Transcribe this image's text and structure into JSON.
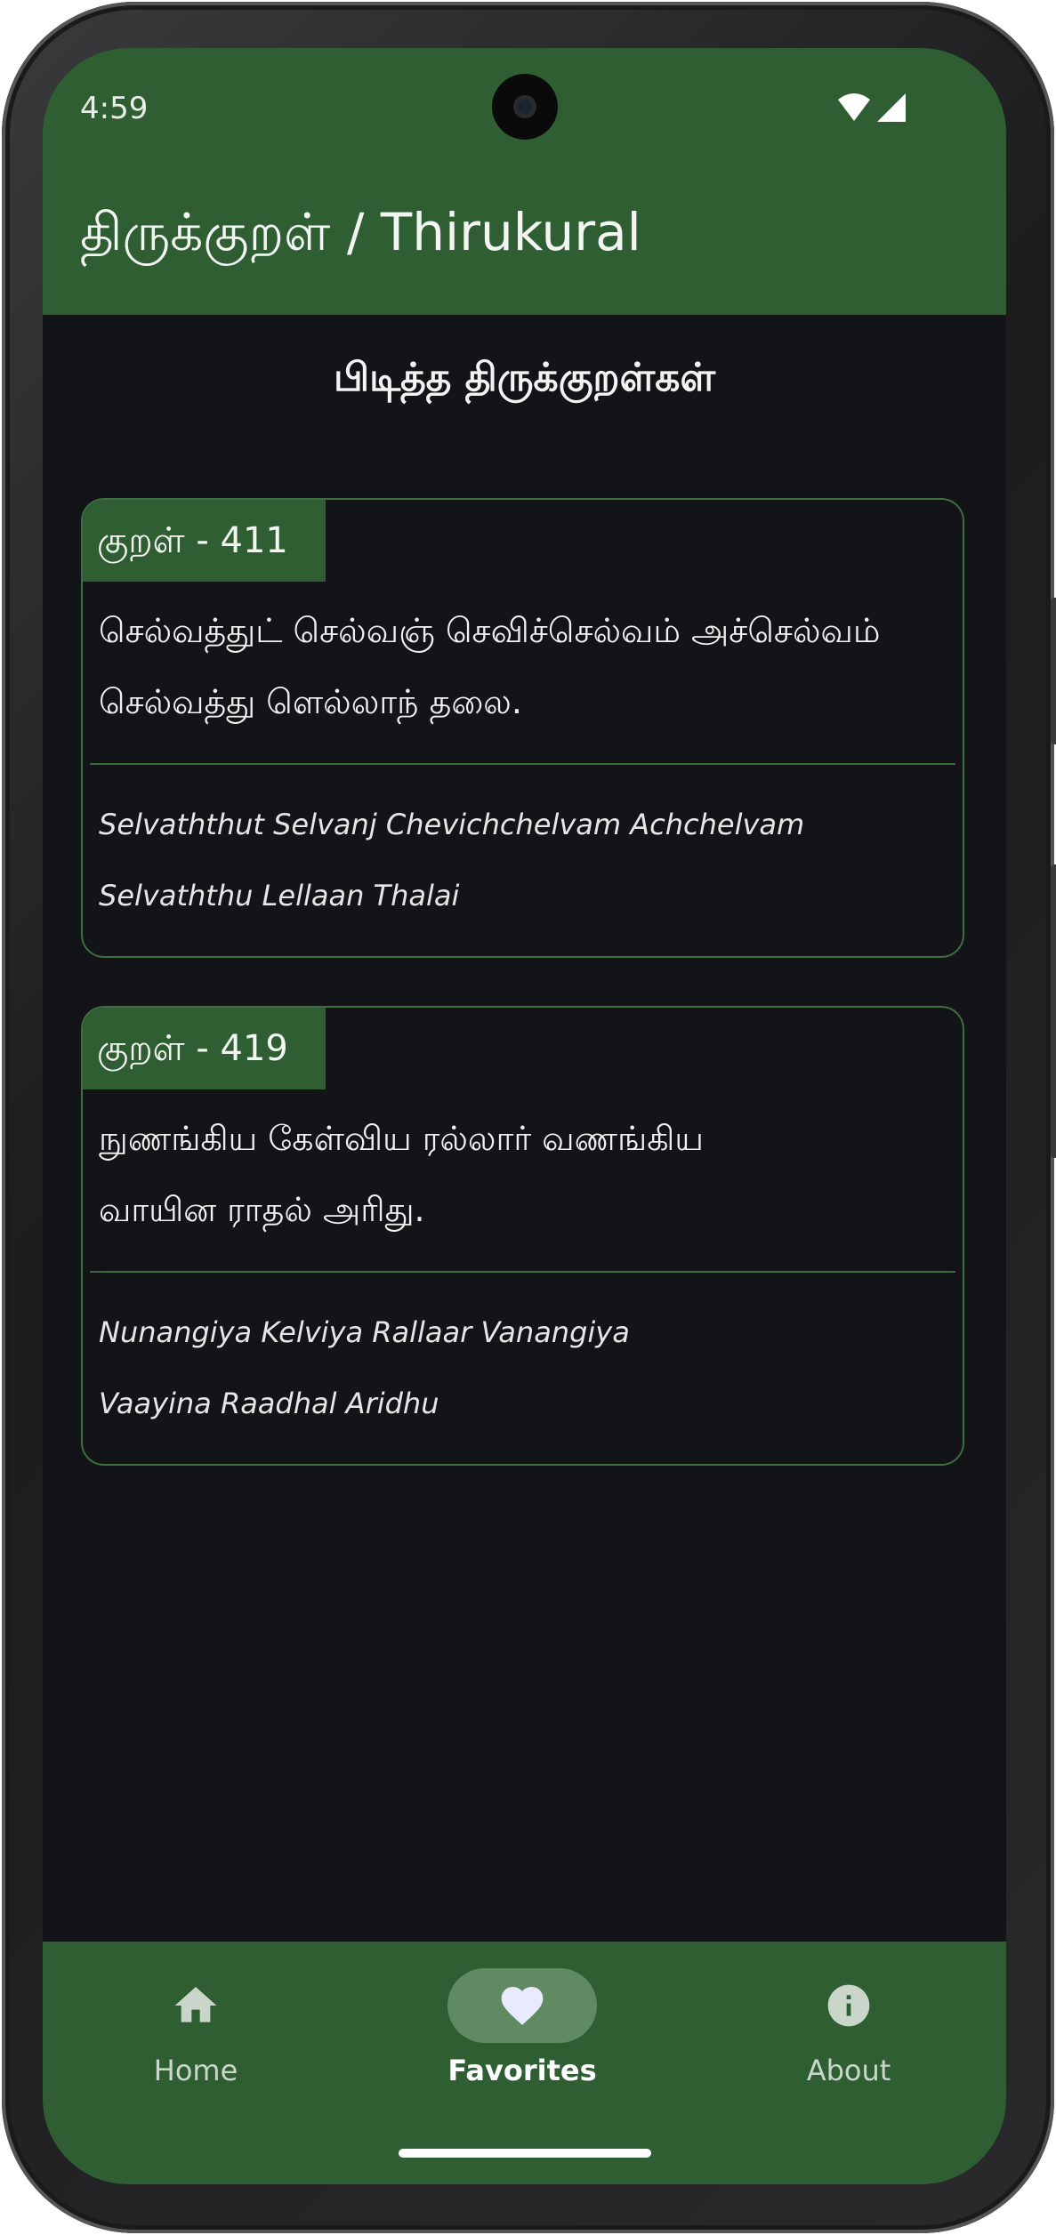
{
  "status_bar": {
    "time": "4:59",
    "icons": [
      "wifi-icon",
      "cellular-signal-icon"
    ]
  },
  "app_bar": {
    "title": "திருக்குறள் / Thirukural"
  },
  "page": {
    "heading": "பிடித்த திருக்குறள்கள்"
  },
  "kurals": [
    {
      "label": "குறள் - 411",
      "tamil": [
        "செல்வத்துட் செல்வஞ் செவிச்செல்வம் அச்செல்வம்",
        "செல்வத்து ளெல்லாந் தலை."
      ],
      "transliteration": [
        "Selvaththut Selvanj Chevichchelvam Achchelvam",
        "Selvaththu Lellaan Thalai"
      ]
    },
    {
      "label": "குறள் - 419",
      "tamil": [
        "நுணங்கிய கேள்விய ரல்லார் வணங்கிய",
        "வாயின ராதல் அரிது."
      ],
      "transliteration": [
        "Nunangiya Kelviya Rallaar Vanangiya",
        "Vaayina Raadhal Aridhu"
      ]
    }
  ],
  "bottom_nav": {
    "items": [
      {
        "label": "Home",
        "icon": "home-icon",
        "selected": false
      },
      {
        "label": "Favorites",
        "icon": "heart-icon",
        "selected": true
      },
      {
        "label": "About",
        "icon": "info-icon",
        "selected": false
      }
    ]
  },
  "colors": {
    "primary_green": "#2f5e33",
    "background": "#131417",
    "card_border": "#3f6d42",
    "selected_pill": "#5f8a62"
  }
}
